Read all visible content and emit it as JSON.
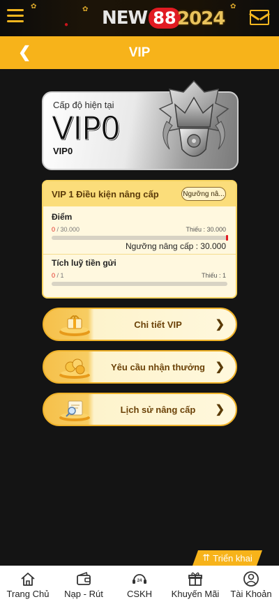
{
  "topbar": {
    "logo_text": "NEW",
    "logo_number": "88",
    "year_text": "2024",
    "menu_icon": "hamburger-menu-icon",
    "mail_icon": "envelope-icon"
  },
  "header": {
    "title": "VIP",
    "back_icon": "chevron-left-icon"
  },
  "level_card": {
    "label": "Cấp độ hiện tại",
    "level_big": "VIP0",
    "level_small": "VIP0",
    "badge_icon": "silver-crown-badge-icon"
  },
  "upgrade": {
    "title": "VIP 1 Điều kiện nâng cấp",
    "threshold_button": "Ngưỡng nâ...",
    "points": {
      "title": "Điểm",
      "current": "0",
      "target": "/ 30.000",
      "missing": "Thiếu : 30.000",
      "threshold": "Ngưỡng nâng cấp :  30.000",
      "progress": 0
    },
    "deposit": {
      "title": "Tích luỹ tiền gửi",
      "current": "0",
      "target": "/ 1",
      "missing": "Thiếu : 1",
      "progress": 0
    }
  },
  "actions": [
    {
      "label": "Chi tiết VIP",
      "icon": "vip-gift-podium-icon"
    },
    {
      "label": "Yêu cầu nhận thưởng",
      "icon": "gold-coins-icon"
    },
    {
      "label": "Lịch sử nâng cấp",
      "icon": "document-search-icon"
    }
  ],
  "expand_label": "Triển khai",
  "bottom_nav": [
    {
      "label": "Trang Chủ",
      "icon": "home-icon"
    },
    {
      "label": "Nạp - Rút",
      "icon": "wallet-icon"
    },
    {
      "label": "CSKH",
      "icon": "support-24-icon"
    },
    {
      "label": "Khuyến Mãi",
      "icon": "gift-icon"
    },
    {
      "label": "Tài Khoản",
      "icon": "user-icon"
    }
  ],
  "colors": {
    "accent": "#f7b31a",
    "background": "#141414",
    "brand_red": "#e11b22"
  }
}
